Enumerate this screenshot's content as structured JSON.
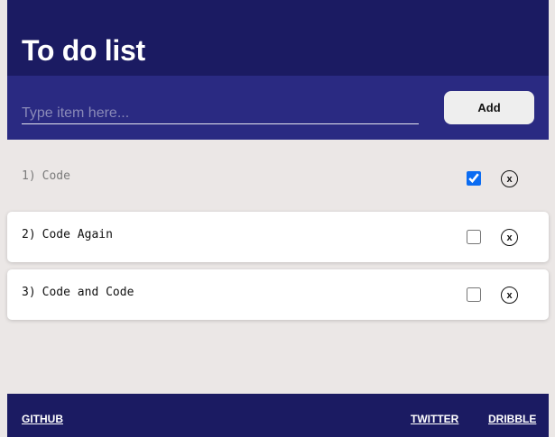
{
  "header": {
    "title": "To do list"
  },
  "input": {
    "placeholder": "Type item here...",
    "value": "",
    "add_label": "Add"
  },
  "todos": [
    {
      "number": "1)",
      "text": "Code",
      "done": true,
      "delete_label": "x"
    },
    {
      "number": "2)",
      "text": "Code Again",
      "done": false,
      "delete_label": "x"
    },
    {
      "number": "3)",
      "text": "Code and Code",
      "done": false,
      "delete_label": "x"
    }
  ],
  "footer": {
    "github": "GITHUB",
    "twitter": "TWITTER",
    "dribble": "DRIBBLE"
  },
  "colors": {
    "header_bg": "#1b1b62",
    "input_bar_bg": "#2a2a82",
    "page_bg": "#ebe7e6",
    "checkbox_accent": "#0b6cf2"
  }
}
